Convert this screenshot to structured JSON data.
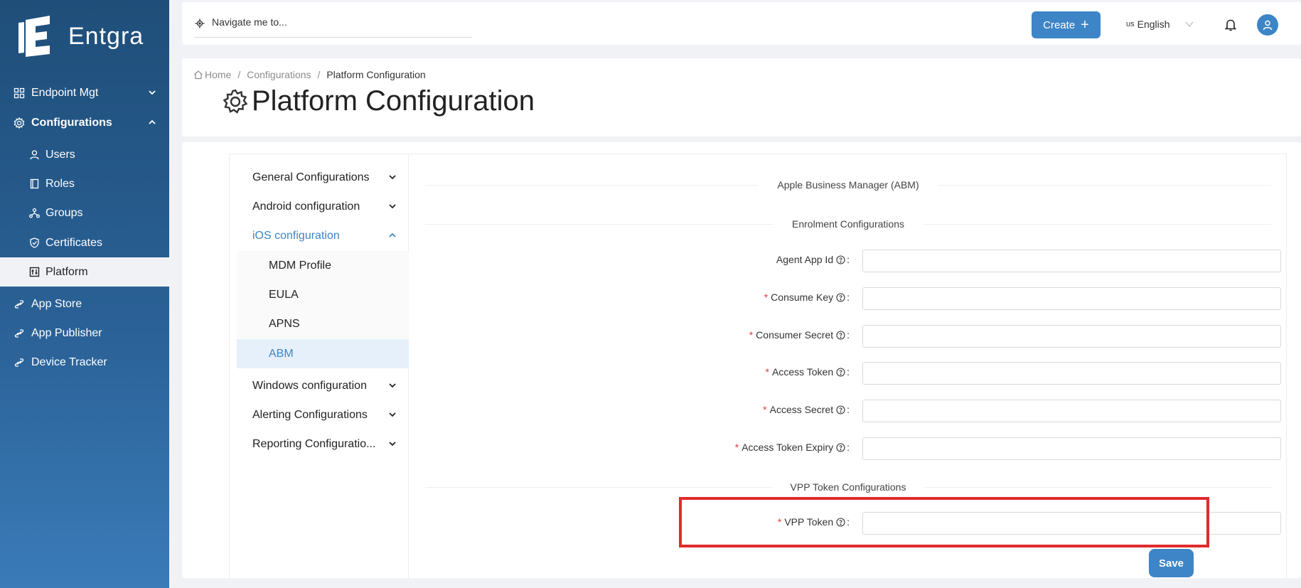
{
  "brand": {
    "name": "Entgra"
  },
  "sidebar": {
    "items": [
      {
        "label": "Endpoint Mgt",
        "icon": "grid-icon"
      },
      {
        "label": "Configurations",
        "icon": "gear-icon"
      },
      {
        "label": "App Store",
        "icon": "link-icon"
      },
      {
        "label": "App Publisher",
        "icon": "link-icon"
      },
      {
        "label": "Device Tracker",
        "icon": "link-icon"
      }
    ],
    "sub_items": [
      {
        "label": "Users",
        "icon": "user-icon"
      },
      {
        "label": "Roles",
        "icon": "book-icon"
      },
      {
        "label": "Groups",
        "icon": "cluster-icon"
      },
      {
        "label": "Certificates",
        "icon": "shield-icon"
      },
      {
        "label": "Platform",
        "icon": "platform-icon"
      }
    ]
  },
  "header": {
    "search_placeholder": "Navigate me to...",
    "create_label": "Create",
    "language_flag": "us",
    "language_label": "English"
  },
  "breadcrumb": {
    "home": "Home",
    "configurations": "Configurations",
    "current": "Platform Configuration"
  },
  "page": {
    "title": "Platform Configuration"
  },
  "submenu": {
    "items": [
      "General Configurations",
      "Android configuration",
      "iOS configuration",
      "Windows configuration",
      "Alerting Configurations",
      "Reporting Configuratio..."
    ],
    "ios_children": [
      "MDM Profile",
      "EULA",
      "APNS",
      "ABM"
    ]
  },
  "form": {
    "section_abm": "Apple Business Manager (ABM)",
    "section_enrolment": "Enrolment Configurations",
    "section_vpp": "VPP Token Configurations",
    "fields": [
      {
        "label": "Agent App Id",
        "required": false,
        "value": ""
      },
      {
        "label": "Consume Key",
        "required": true,
        "value": ""
      },
      {
        "label": "Consumer Secret",
        "required": true,
        "value": ""
      },
      {
        "label": "Access Token",
        "required": true,
        "value": ""
      },
      {
        "label": "Access Secret",
        "required": true,
        "value": ""
      },
      {
        "label": "Access Token Expiry",
        "required": true,
        "value": ""
      }
    ],
    "vpp_field": {
      "label": "VPP Token",
      "required": true,
      "value": ""
    },
    "required_mark": "*",
    "colon": ":",
    "save_label": "Save"
  },
  "colors": {
    "primary": "#3d85c6",
    "sidebar_top": "#1f4e79",
    "highlight": "#e02b2b",
    "required": "#e53935"
  }
}
